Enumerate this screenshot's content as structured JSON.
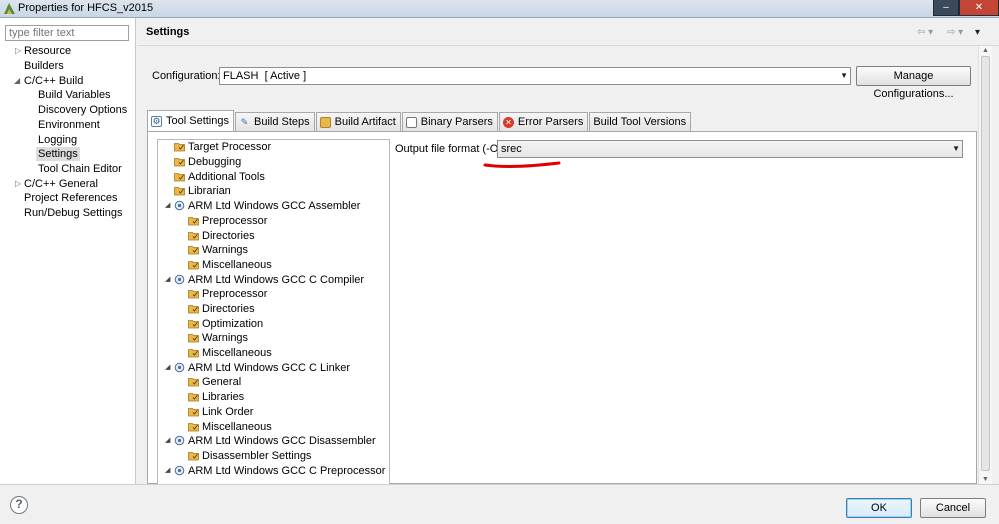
{
  "window": {
    "title": "Properties for HFCS_v2015"
  },
  "filter": {
    "placeholder": "type filter text"
  },
  "nav": {
    "items": [
      {
        "label": "Resource"
      },
      {
        "label": "Builders"
      },
      {
        "label": "C/C++ Build"
      },
      {
        "label": "Build Variables"
      },
      {
        "label": "Discovery Options"
      },
      {
        "label": "Environment"
      },
      {
        "label": "Logging"
      },
      {
        "label": "Settings"
      },
      {
        "label": "Tool Chain Editor"
      },
      {
        "label": "C/C++ General"
      },
      {
        "label": "Project References"
      },
      {
        "label": "Run/Debug Settings"
      }
    ],
    "selected": "Settings"
  },
  "header": {
    "title": "Settings"
  },
  "configuration": {
    "label": "Configuration:",
    "value": "FLASH  [ Active ]",
    "manage_button": "Manage Configurations..."
  },
  "tabs": [
    {
      "label": "Tool Settings",
      "icon": "tool-settings-icon",
      "active": true
    },
    {
      "label": "Build Steps",
      "icon": "build-steps-icon"
    },
    {
      "label": "Build Artifact",
      "icon": "build-artifact-icon"
    },
    {
      "label": "Binary Parsers",
      "icon": "binary-parsers-icon"
    },
    {
      "label": "Error Parsers",
      "icon": "error-parsers-icon"
    },
    {
      "label": "Build Tool Versions"
    }
  ],
  "tree": [
    {
      "label": "Target Processor"
    },
    {
      "label": "Debugging"
    },
    {
      "label": "Additional Tools"
    },
    {
      "label": "Librarian"
    },
    {
      "label": "ARM Ltd Windows GCC Assembler"
    },
    {
      "label": "Preprocessor"
    },
    {
      "label": "Directories"
    },
    {
      "label": "Warnings"
    },
    {
      "label": "Miscellaneous"
    },
    {
      "label": "ARM Ltd Windows GCC C Compiler"
    },
    {
      "label": "Preprocessor"
    },
    {
      "label": "Directories"
    },
    {
      "label": "Optimization"
    },
    {
      "label": "Warnings"
    },
    {
      "label": "Miscellaneous"
    },
    {
      "label": "ARM Ltd Windows GCC C Linker"
    },
    {
      "label": "General"
    },
    {
      "label": "Libraries"
    },
    {
      "label": "Link Order"
    },
    {
      "label": "Miscellaneous"
    },
    {
      "label": "ARM Ltd Windows GCC Disassembler"
    },
    {
      "label": "Disassembler Settings"
    },
    {
      "label": "ARM Ltd Windows GCC C Preprocessor"
    }
  ],
  "option": {
    "label": "Output file format (-O)",
    "value": "srec"
  },
  "footer": {
    "help": "?",
    "ok": "OK",
    "cancel": "Cancel"
  },
  "colors": {
    "annotation": "#e00000",
    "folder": "#e9b84a",
    "selection": "#dcdcdc",
    "ok_border": "#3c7fb1"
  }
}
